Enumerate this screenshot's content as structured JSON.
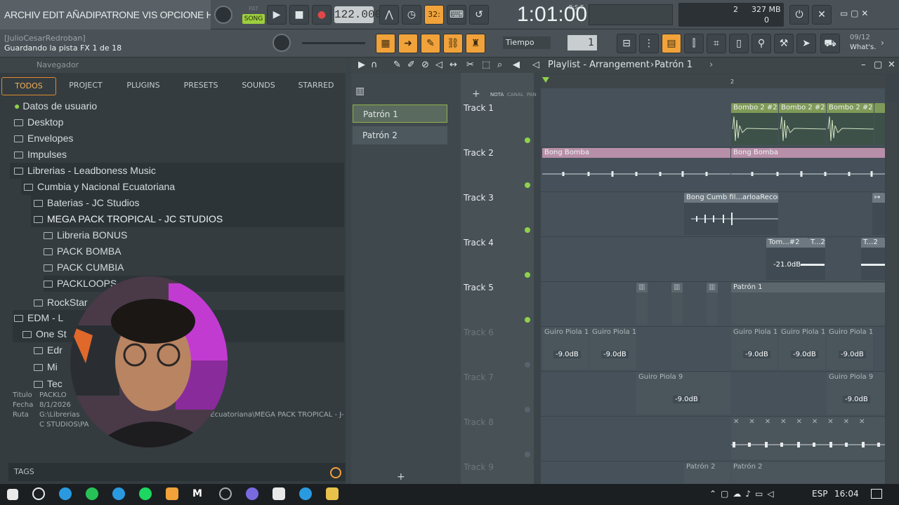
{
  "menu": "ARCHIV EDIT AÑADIPATRONE VIS OPCIONE HERRAMIENT A",
  "transport": {
    "pat": "PAT",
    "song": "SONG",
    "tempo": "122.000",
    "clock": "1:01:00",
    "clock_label": "B:S:T",
    "step": "32:"
  },
  "cpu": {
    "mb": "327 MB",
    "voices": "2",
    "poly": "0"
  },
  "hint": {
    "user": "[JulioCesarRedroban]",
    "status": "Guardando la pista FX 1 de 18"
  },
  "snap": {
    "label": "Tiempo",
    "value": "1"
  },
  "whats": {
    "date": "09/12",
    "text": "What's."
  },
  "browser": {
    "header": "Navegador",
    "tabs": [
      "TODOS",
      "PROJECT",
      "PLUGINS",
      "PRESETS",
      "SOUNDS",
      "STARRED"
    ],
    "tree": [
      "Datos de usuario",
      "Desktop",
      "Envelopes",
      "Impulses",
      "Librerias - Leadboness Music",
      "Cumbia y Nacional Ecuatoriana",
      "Baterias - JC Studios",
      "MEGA PACK TROPICAL - JC STUDIOS",
      "Libreria BONUS",
      "PACK BOMBA",
      "PACK CUMBIA",
      "PACKLOOPS",
      "RockStar",
      "EDM - L",
      "One St",
      "Edr",
      "Mi",
      "Tec"
    ],
    "meta_labels": [
      "Titulo",
      "Fecha",
      "Ruta"
    ],
    "meta_values": [
      "PACKLO",
      "8/1/2026",
      "G:\\Librerias"
    ],
    "path_tail": "a Ecuatoriana\\MEGA PACK TROPICAL - J-",
    "path_tail2": "C STUDIOS\\PA",
    "tags": "TAGS"
  },
  "playlist": {
    "title": "Playlist - Arrangement",
    "pattern": "Patrón 1",
    "patterns": [
      "Patrón 1",
      "Patrón 2"
    ],
    "columns": [
      "NOTA",
      "CANAL",
      "PAN"
    ],
    "bar_marker": "2",
    "tracks": [
      "Track 1",
      "Track 2",
      "Track 3",
      "Track 4",
      "Track 5",
      "Track 6",
      "Track 7",
      "Track 8",
      "Track 9"
    ],
    "clips": {
      "bombo": "Bombo 2 #2",
      "bong": "Bong Bomba",
      "cumb": "Bong Cumb fil...arloaRecord's",
      "tom1": "Tom...#2",
      "t2": "T...2",
      "pat1": "Patrón 1",
      "guiro1": "Guiro Piola 1",
      "guiro9": "Guiro Piola 9",
      "pat2": "Patrón 2",
      "db21": "-21.0dB",
      "db9": "-9.0dB"
    }
  },
  "taskbar": {
    "lang": "ESP",
    "time": "16:04"
  },
  "colors": {
    "accent": "#f1a23a",
    "green_led": "#8fd14a",
    "song": "#9ecf3e"
  }
}
